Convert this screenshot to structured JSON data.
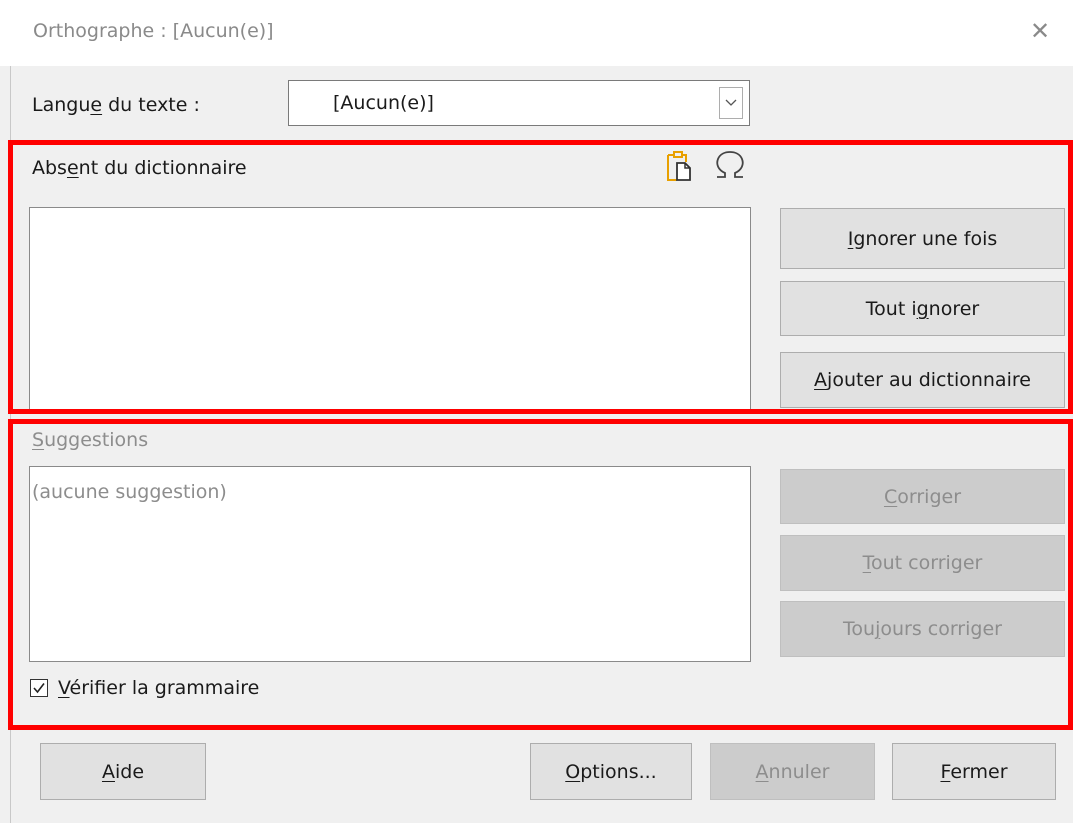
{
  "window": {
    "title": "Orthographe : [Aucun(e)]",
    "close_glyph": "✕"
  },
  "language": {
    "label_pre": "Langu",
    "label_mn": "e",
    "label_post": " du texte :",
    "value": "[Aucun(e)]"
  },
  "not_in_dict": {
    "label_pre": "Abs",
    "label_mn": "e",
    "label_post": "nt du dictionnaire",
    "text": ""
  },
  "buttons_right_top": {
    "ignore_once": {
      "mn": "I",
      "rest": "gnorer une fois"
    },
    "ignore_all": {
      "pre": "Tout i",
      "mn": "g",
      "post": "norer"
    },
    "add_dict": {
      "mn": "A",
      "rest": "jouter au dictionnaire"
    }
  },
  "suggestions": {
    "label_mn": "S",
    "label_rest": "uggestions",
    "items": [
      "(aucune suggestion)"
    ]
  },
  "buttons_right_bottom": {
    "correct": {
      "mn": "C",
      "rest": "orriger"
    },
    "correct_all": {
      "mn": "T",
      "rest": "out corriger"
    },
    "always_correct": {
      "pre": "Tou",
      "mn": "j",
      "post": "ours corriger"
    }
  },
  "grammar": {
    "mn": "V",
    "rest": "érifier la grammaire",
    "checked": true
  },
  "footer": {
    "help": {
      "mn": "A",
      "rest": "ide"
    },
    "options": {
      "mn": "O",
      "rest": "ptions..."
    },
    "undo": {
      "mn": "A",
      "rest": "nnuler"
    },
    "close": {
      "mn": "F",
      "rest": "ermer"
    }
  },
  "colors": {
    "highlight": "#ff0000",
    "disabled_text": "#8d8d8d",
    "icon_accent": "#e8a000"
  },
  "icons": [
    "clipboard-paste-icon",
    "omega-special-char-icon",
    "chevron-down-icon",
    "checkmark-icon",
    "close-icon"
  ]
}
